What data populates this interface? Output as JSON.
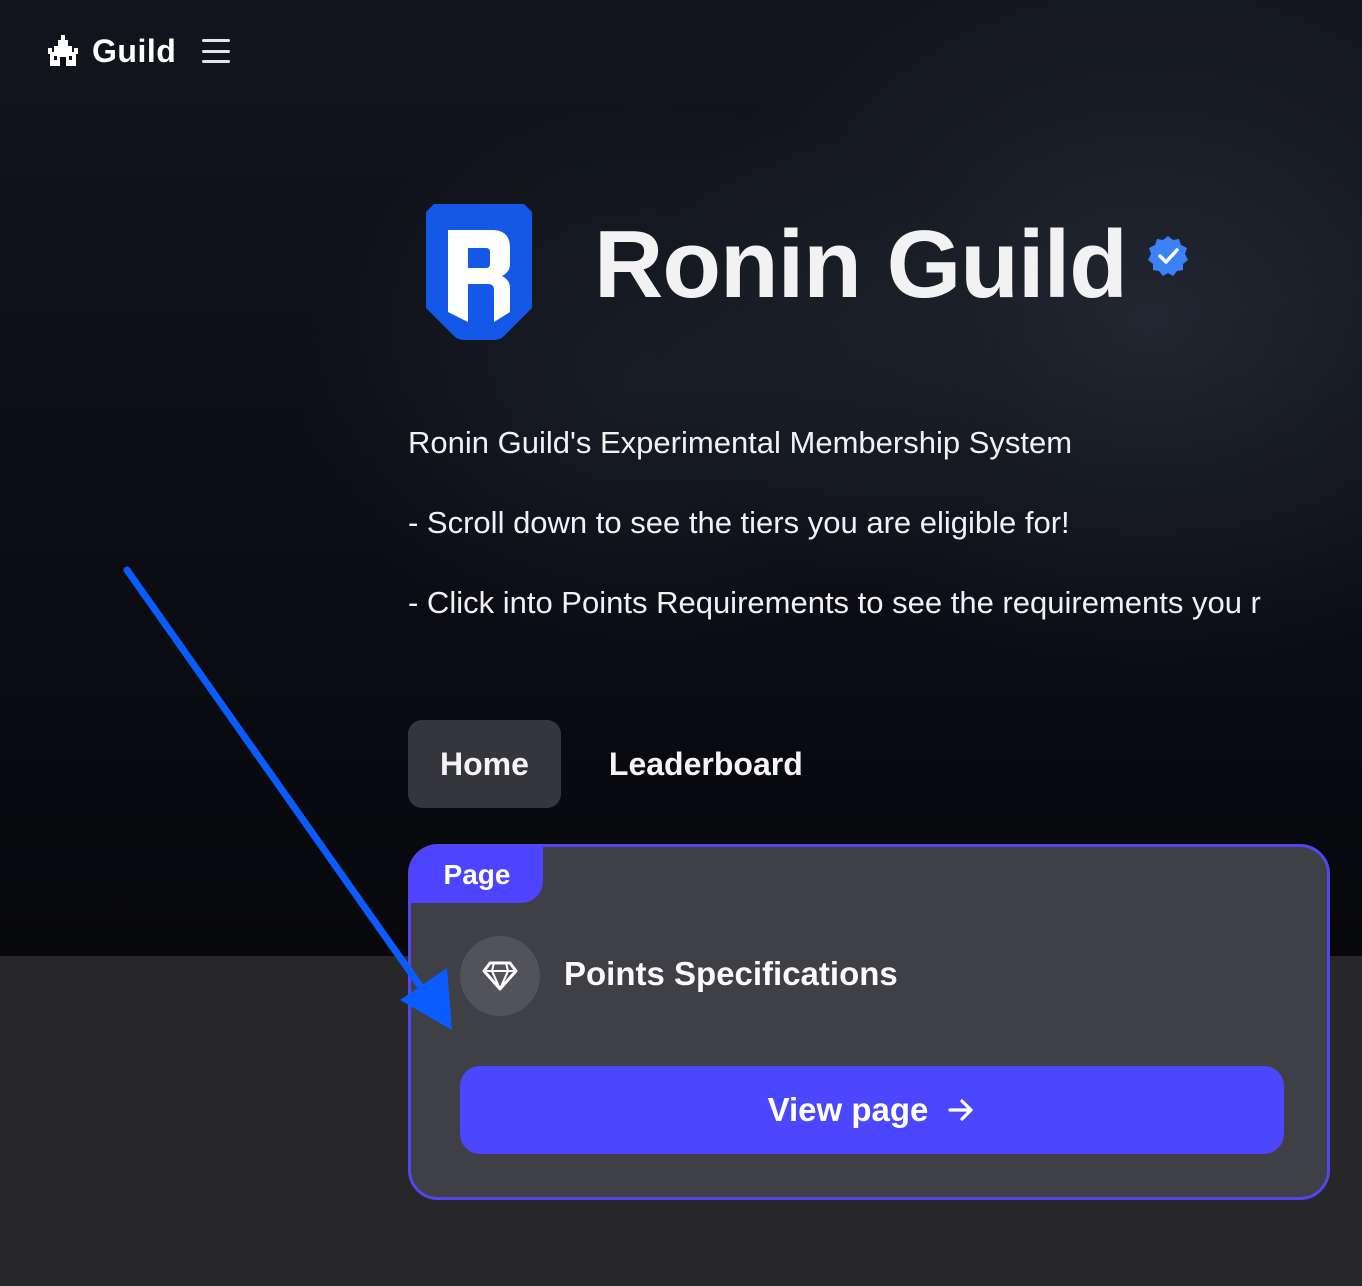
{
  "header": {
    "brand_name": "Guild",
    "brand_icon": "castle-icon",
    "menu_icon": "hamburger-menu-icon"
  },
  "guild": {
    "name": "Ronin Guild",
    "logo_icon": "ronin-shield-logo",
    "verified_icon": "verified-badge-icon",
    "description": [
      "Ronin Guild's Experimental Membership System",
      "- Scroll down to see the tiers you are eligible for!",
      "- Click into Points Requirements to see the requirements you r"
    ]
  },
  "tabs": [
    {
      "label": "Home",
      "active": true
    },
    {
      "label": "Leaderboard",
      "active": false
    }
  ],
  "card": {
    "tag": "Page",
    "icon": "diamond-icon",
    "title": "Points Specifications",
    "button_label": "View page",
    "button_icon": "arrow-right-icon"
  },
  "colors": {
    "accent": "#4a47ff",
    "card_border": "#5146f0",
    "card_bg": "#3f3f46",
    "annotation_arrow": "#0a5cff",
    "ronin_blue": "#1358e6"
  }
}
